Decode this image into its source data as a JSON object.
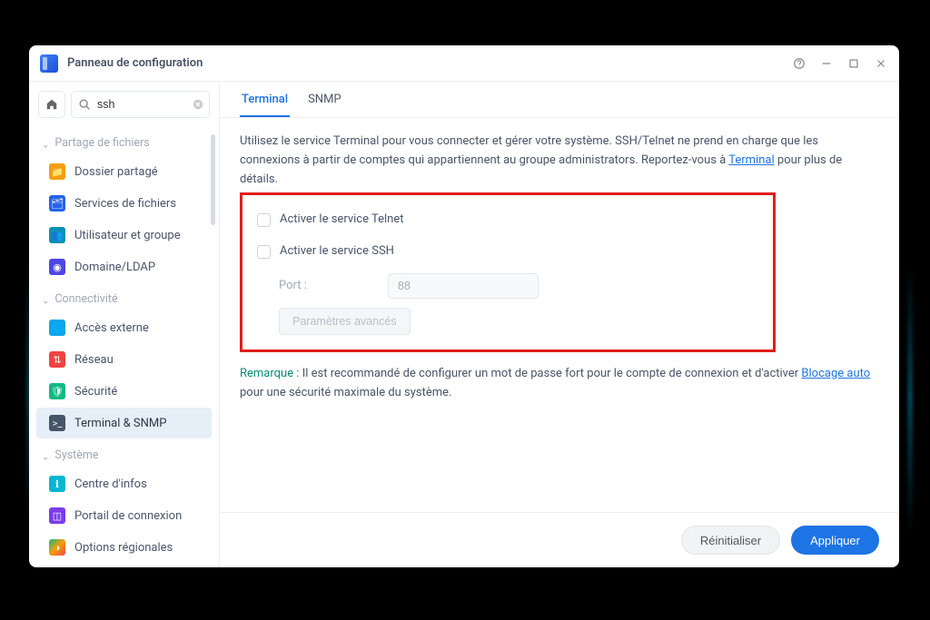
{
  "window": {
    "title": "Panneau de configuration"
  },
  "search": {
    "value": "ssh",
    "placeholder": ""
  },
  "sidebar": {
    "section_share": "Partage de fichiers",
    "section_conn": "Connectivité",
    "section_sys": "Système",
    "items": {
      "shared_folder": "Dossier partagé",
      "file_services": "Services de fichiers",
      "user_group": "Utilisateur et groupe",
      "domain_ldap": "Domaine/LDAP",
      "external_access": "Accès externe",
      "network": "Réseau",
      "security": "Sécurité",
      "terminal_snmp": "Terminal & SNMP",
      "info_center": "Centre d'infos",
      "login_portal": "Portail de connexion",
      "regional": "Options régionales"
    }
  },
  "tabs": {
    "terminal": "Terminal",
    "snmp": "SNMP"
  },
  "content": {
    "intro_pre": "Utilisez le service Terminal pour vous connecter et gérer votre système. SSH/Telnet ne prend en charge que les connexions à partir de comptes qui appartiennent au groupe administrators. Reportez-vous à ",
    "intro_link": "Terminal",
    "intro_post": " pour plus de détails.",
    "enable_telnet": "Activer le service Telnet",
    "enable_ssh": "Activer le service SSH",
    "port_label": "Port :",
    "port_value": "88",
    "advanced_btn": "Paramètres avancés",
    "note_label": "Remarque",
    "note_pre": " : Il est recommandé de configurer un mot de passe fort pour le compte de connexion et d'activer ",
    "note_link": "Blocage auto",
    "note_post": " pour une sécurité maximale du système."
  },
  "footer": {
    "reset": "Réinitialiser",
    "apply": "Appliquer"
  }
}
